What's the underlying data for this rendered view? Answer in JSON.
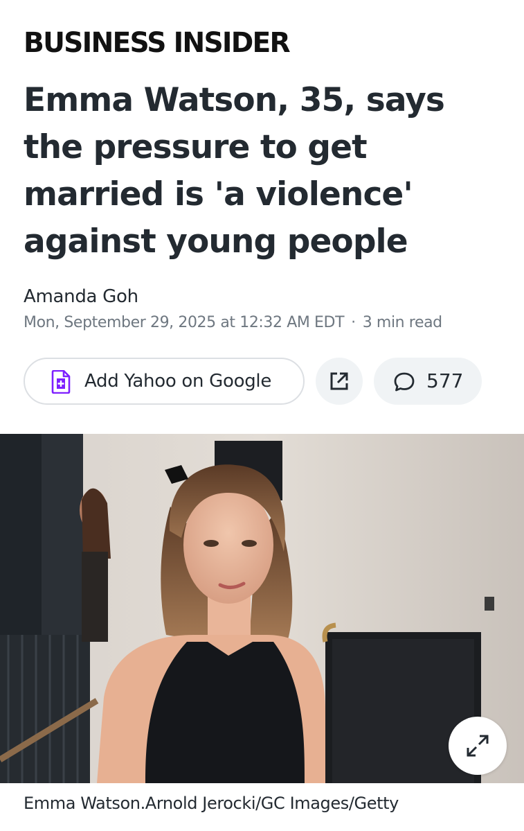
{
  "publisher": {
    "name": "BUSINESS INSIDER"
  },
  "article": {
    "headline": "Emma Watson, 35, says the pressure to get married is 'a violence' against young people",
    "author": "Amanda Goh",
    "published": "Mon, September 29, 2025 at 12:32 AM EDT",
    "separator": "·",
    "read_time": "3 min read"
  },
  "actions": {
    "add_source_label": "Add Yahoo on Google",
    "add_source_icon": "doc-plus-icon",
    "share_icon": "external-link-icon",
    "comments_icon": "speech-bubble-icon",
    "comments_count": "577"
  },
  "media": {
    "expand_icon": "expand-arrows-icon",
    "caption": "Emma Watson.Arnold Jerocki/GC Images/Getty"
  },
  "colors": {
    "accent": "#7e1fff",
    "text": "#232a31",
    "muted": "#6e7780",
    "button_bg": "#f0f3f5",
    "border": "#dcdfe3"
  }
}
